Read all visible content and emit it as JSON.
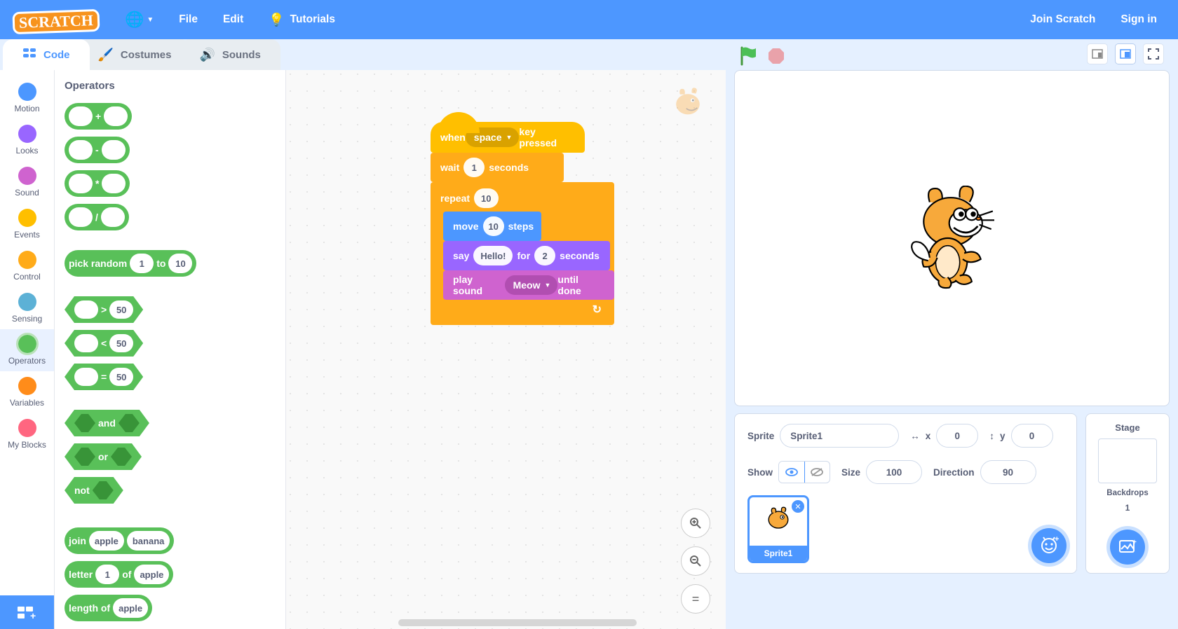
{
  "menubar": {
    "logo": "SCRATCH",
    "file": "File",
    "edit": "Edit",
    "tutorials": "Tutorials",
    "join": "Join Scratch",
    "signin": "Sign in"
  },
  "tabs": {
    "code": "Code",
    "costumes": "Costumes",
    "sounds": "Sounds"
  },
  "categories": [
    {
      "name": "Motion",
      "color": "#4c97ff"
    },
    {
      "name": "Looks",
      "color": "#9966ff"
    },
    {
      "name": "Sound",
      "color": "#cf63cf"
    },
    {
      "name": "Events",
      "color": "#ffbf00"
    },
    {
      "name": "Control",
      "color": "#ffab19"
    },
    {
      "name": "Sensing",
      "color": "#5cb1d6"
    },
    {
      "name": "Operators",
      "color": "#59c059"
    },
    {
      "name": "Variables",
      "color": "#ff8c1a"
    },
    {
      "name": "My Blocks",
      "color": "#ff6680"
    }
  ],
  "active_category": "Operators",
  "palette_title": "Operators",
  "palette": {
    "add": "+",
    "sub": "-",
    "mul": "*",
    "div": "/",
    "pickrandom_pre": "pick random",
    "to": "to",
    "pr1": "1",
    "pr2": "10",
    "gt": ">",
    "lt": "<",
    "eq": "=",
    "fifty": "50",
    "and": "and",
    "or": "or",
    "not": "not",
    "join": "join",
    "apple": "apple",
    "banana": "banana",
    "letter": "letter",
    "one": "1",
    "of": "of",
    "lengthof": "length of"
  },
  "script": {
    "hat_pre": "when",
    "hat_key": "space",
    "hat_post": "key pressed",
    "wait_pre": "wait",
    "wait_val": "1",
    "wait_post": "seconds",
    "repeat_pre": "repeat",
    "repeat_val": "10",
    "move_pre": "move",
    "move_val": "10",
    "move_post": "steps",
    "say_pre": "say",
    "say_val": "Hello!",
    "say_mid": "for",
    "say_n": "2",
    "say_post": "seconds",
    "sound_pre": "play sound",
    "sound_val": "Meow",
    "sound_post": "until done"
  },
  "sprite_info": {
    "sprite_label": "Sprite",
    "sprite_name": "Sprite1",
    "x_label": "x",
    "x": "0",
    "y_label": "y",
    "y": "0",
    "show_label": "Show",
    "size_label": "Size",
    "size": "100",
    "direction_label": "Direction",
    "direction": "90",
    "thumb_name": "Sprite1"
  },
  "stage_panel": {
    "title": "Stage",
    "backdrops_label": "Backdrops",
    "backdrops_count": "1"
  }
}
